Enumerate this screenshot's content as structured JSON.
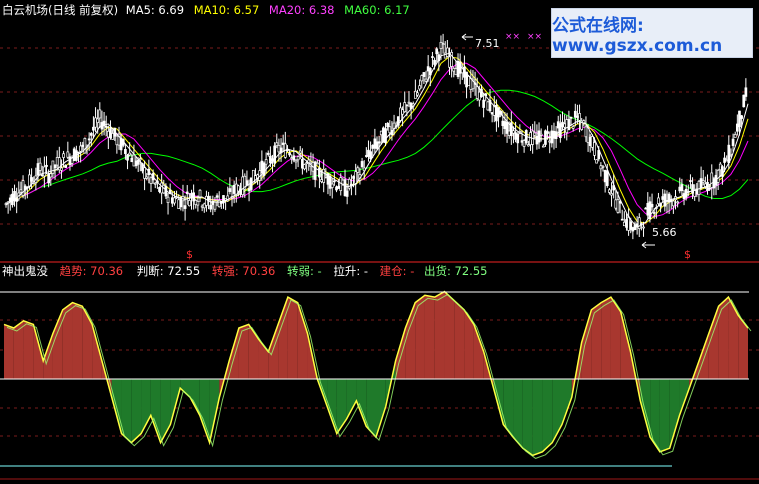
{
  "upper_header": {
    "stock": "白云机场(日线 前复权)",
    "ma5": "MA5: 6.69",
    "ma10": "MA10: 6.57",
    "ma20": "MA20: 6.38",
    "ma60": "MA60: 6.17"
  },
  "lower_header": {
    "indicator": "神出鬼没",
    "trend": "趋势: 70.36",
    "judge": "判断: 72.55",
    "turn_strong": "转强: 70.36",
    "turn_weak": "转弱: -",
    "pull_up": "拉升: -",
    "build": "建仓: -",
    "ship": "出货: 72.55"
  },
  "annotations": {
    "high": "7.51",
    "low": "5.66",
    "marks": [
      "××",
      "××"
    ],
    "signal_1": "$",
    "signal_2": "$"
  },
  "watermark": "公式在线网: www.gszx.com.cn",
  "colors": {
    "background": "#000000",
    "red_fill": "#a8372f",
    "green_fill": "#1f7a2a",
    "candle": "#ffffff",
    "ma5": "#ffffff",
    "ma10": "#ffff00",
    "ma20": "#ff00ff",
    "ma60": "#00ff00",
    "trend_line": "#ffff40",
    "judge_line": "#a0ff70",
    "grid_red": "#7a1d1d",
    "level_white": "#ffffff",
    "level_cyan": "#80ffff"
  },
  "chart_data": [
    {
      "type": "line",
      "title": "白云机场(日线 前复权)",
      "series": [
        {
          "name": "MA5",
          "last": 6.69
        },
        {
          "name": "MA10",
          "last": 6.57
        },
        {
          "name": "MA20",
          "last": 6.38
        },
        {
          "name": "MA60",
          "last": 6.17
        }
      ],
      "close": [
        5.95,
        6.05,
        6.1,
        6.2,
        6.3,
        6.25,
        6.35,
        6.4,
        6.45,
        6.5,
        6.65,
        6.8,
        6.7,
        6.6,
        6.5,
        6.4,
        6.3,
        6.2,
        6.1,
        6.05,
        6.0,
        6.0,
        6.05,
        6.0,
        5.95,
        6.0,
        6.0,
        6.1,
        6.15,
        6.2,
        6.3,
        6.4,
        6.5,
        6.5,
        6.45,
        6.35,
        6.3,
        6.25,
        6.2,
        6.15,
        6.1,
        6.2,
        6.35,
        6.5,
        6.6,
        6.7,
        6.8,
        6.9,
        7.0,
        7.2,
        7.35,
        7.5,
        7.4,
        7.3,
        7.2,
        7.1,
        7.0,
        6.9,
        6.8,
        6.7,
        6.65,
        6.6,
        6.6,
        6.6,
        6.65,
        6.7,
        6.75,
        6.8,
        6.7,
        6.5,
        6.3,
        6.1,
        5.9,
        5.75,
        5.7,
        5.85,
        5.95,
        6.0,
        6.0,
        6.05,
        6.1,
        6.1,
        6.15,
        6.2,
        6.3,
        6.5,
        6.8,
        7.1
      ],
      "high_label": 7.51,
      "low_label": 5.66
    },
    {
      "type": "area",
      "title": "神出鬼没",
      "series": [
        {
          "name": "趋势",
          "last": 70.36
        },
        {
          "name": "判断",
          "last": 72.55
        }
      ],
      "values": [
        80,
        78,
        82,
        80,
        60,
        75,
        88,
        92,
        90,
        80,
        60,
        40,
        20,
        15,
        20,
        30,
        15,
        25,
        45,
        40,
        30,
        15,
        40,
        60,
        78,
        80,
        72,
        65,
        80,
        95,
        92,
        75,
        50,
        35,
        20,
        28,
        38,
        24,
        18,
        35,
        60,
        78,
        92,
        96,
        95,
        98,
        93,
        88,
        80,
        65,
        45,
        25,
        18,
        12,
        8,
        10,
        15,
        25,
        40,
        70,
        88,
        92,
        95,
        87,
        65,
        38,
        18,
        10,
        12,
        30,
        45,
        60,
        75,
        90,
        95,
        85,
        78
      ]
    }
  ]
}
